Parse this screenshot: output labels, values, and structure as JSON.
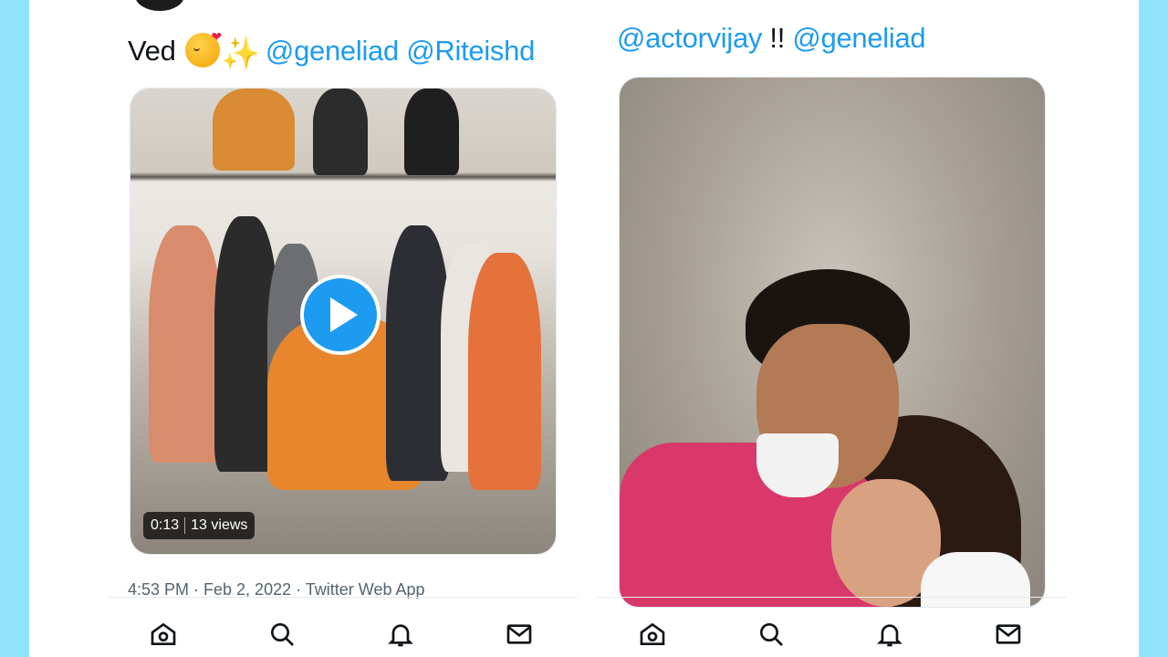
{
  "left_tweet": {
    "text_prefix": "Ved ",
    "emoji_kiss": "face-blowing-a-kiss",
    "emoji_sparkles": "sparkles",
    "mention_1": "@geneliad",
    "mention_2": "@Riteishd",
    "video": {
      "duration": "0:13",
      "views": "13 views",
      "play_icon": "play-icon"
    },
    "meta": "4:53 PM · Feb 2, 2022 · Twitter Web App"
  },
  "right_tweet": {
    "mention_1": "@actorvijay",
    "separator": " !! ",
    "mention_2": "@geneliad"
  },
  "nav": {
    "icons": [
      "home-icon",
      "search-icon",
      "bell-icon",
      "mail-icon"
    ]
  },
  "colors": {
    "background": "#8fe3fb",
    "accent": "#1d9bf0",
    "text": "#0f1419",
    "muted": "#536471"
  }
}
